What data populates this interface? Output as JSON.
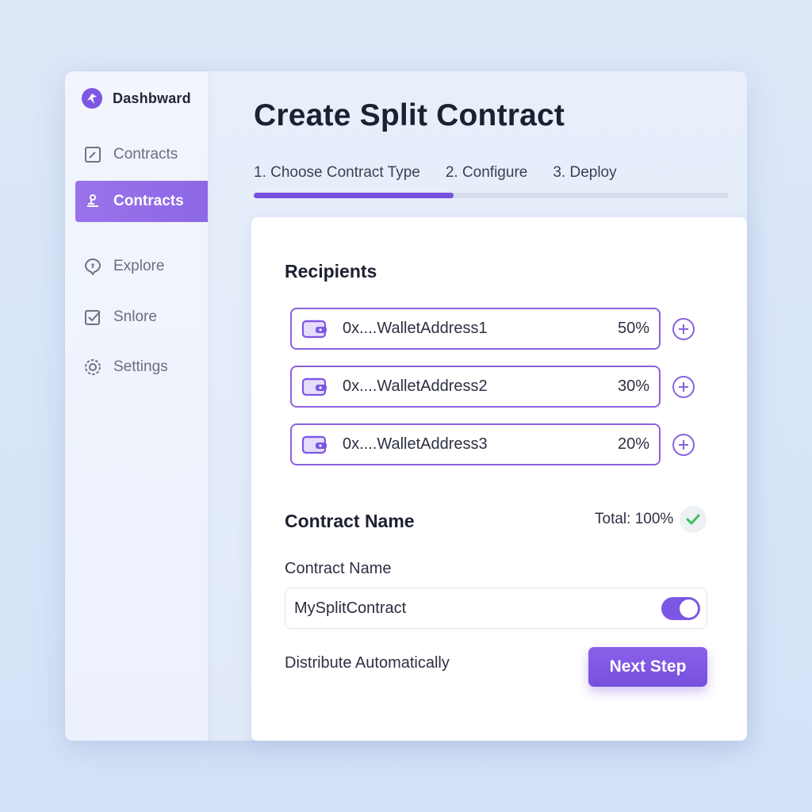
{
  "colors": {
    "accent": "#7d57e3",
    "accent_border": "#8a62dd",
    "success": "#3cc25a",
    "background": "#dde8f8"
  },
  "sidebar": {
    "brand_label": "Dashbward",
    "brand_icon": "brand-logo-icon",
    "items": [
      {
        "label": "Contracts",
        "icon": "edit-square-icon",
        "active": false
      },
      {
        "label": "Contracts",
        "icon": "hand-coin-icon",
        "active": true
      },
      {
        "label": "Explore",
        "icon": "map-pin-chat-icon",
        "active": false
      },
      {
        "label": "Snlore",
        "icon": "checkbox-icon",
        "active": false
      },
      {
        "label": "Settings",
        "icon": "gear-icon",
        "active": false
      }
    ]
  },
  "main": {
    "title": "Create Split Contract",
    "steps": [
      "1. Choose Contract Type",
      "2. Configure",
      "3. Deploy"
    ],
    "progress": 0.42
  },
  "form": {
    "recipients_title": "Recipients",
    "recipients": [
      {
        "address": "0x....WalletAddress1",
        "percent": "50%"
      },
      {
        "address": "0x....WalletAddress2",
        "percent": "30%"
      },
      {
        "address": "0x....WalletAddress3",
        "percent": "20%"
      }
    ],
    "contract_name_title": "Contract Name",
    "total": "Total: 100%",
    "contract_name_label": "Contract Name",
    "contract_name_value": "MySplitContract",
    "distribute_label": "Distribute Automatically",
    "distribute_on": true,
    "next_label": "Next Step"
  }
}
